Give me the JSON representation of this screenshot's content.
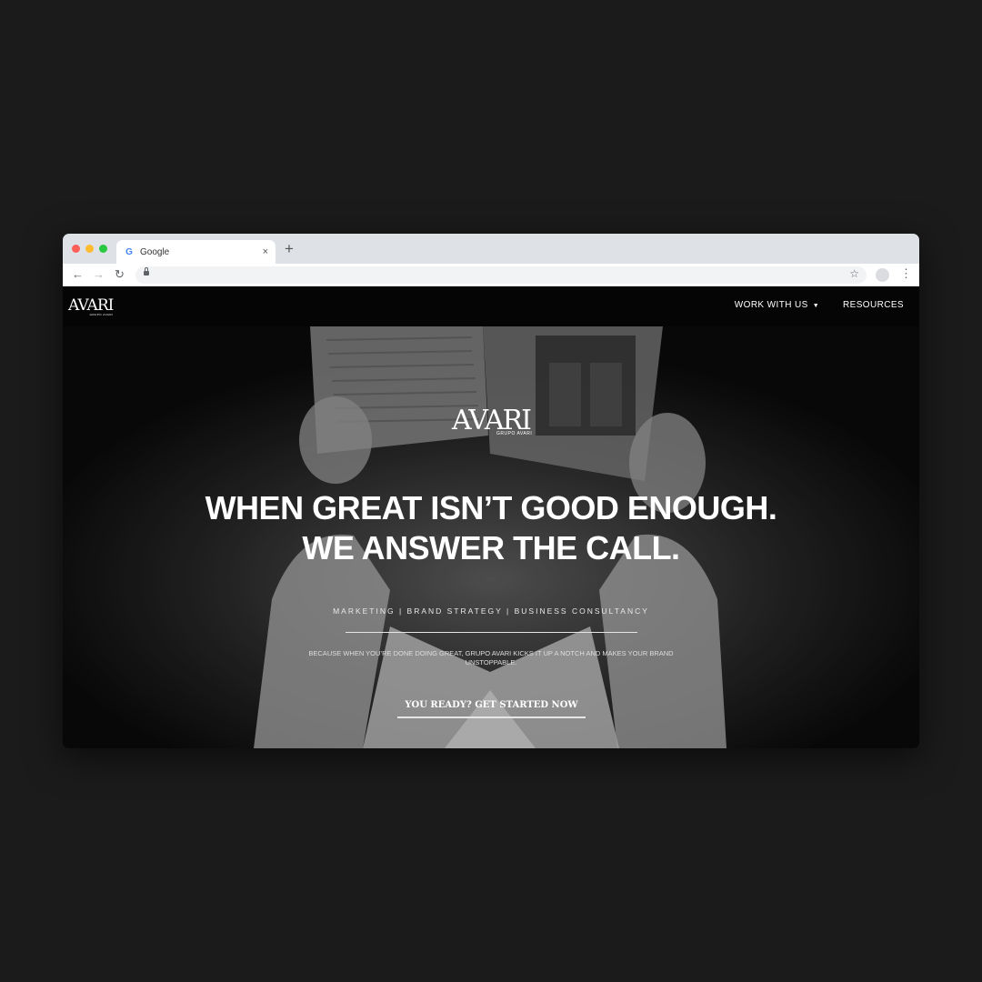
{
  "browser": {
    "tab_title": "Google",
    "tab_favicon": "G",
    "new_tab": "+",
    "tab_close": "×",
    "back": "←",
    "forward": "→",
    "reload": "↻",
    "bookmark": "☆",
    "menu": "⋮"
  },
  "site": {
    "nav_logo": "AVARI",
    "nav_logo_sub": "GRUPO AVARI",
    "nav": {
      "work_with_us": "WORK WITH US",
      "caret": "▼",
      "resources": "RESOURCES"
    },
    "hero": {
      "logo": "AVARI",
      "logo_sub": "GRUPO AVARI",
      "headline_line1": "WHEN GREAT ISN’T GOOD ENOUGH.",
      "headline_line2": "WE ANSWER THE CALL.",
      "services": "MARKETING | BRAND STRATEGY | BUSINESS CONSULTANCY",
      "tagline": "BECAUSE WHEN YOU’RE DONE DOING GREAT, GRUPO AVARI KICKS IT UP A NOTCH AND MAKES YOUR BRAND UNSTOPPABLE.",
      "cta": "YOU READY? GET STARTED NOW"
    }
  },
  "colors": {
    "page_bg": "#1b1b1b",
    "tabstrip": "#dee1e6",
    "site_nav": "#050505",
    "text_white": "#ffffff"
  }
}
